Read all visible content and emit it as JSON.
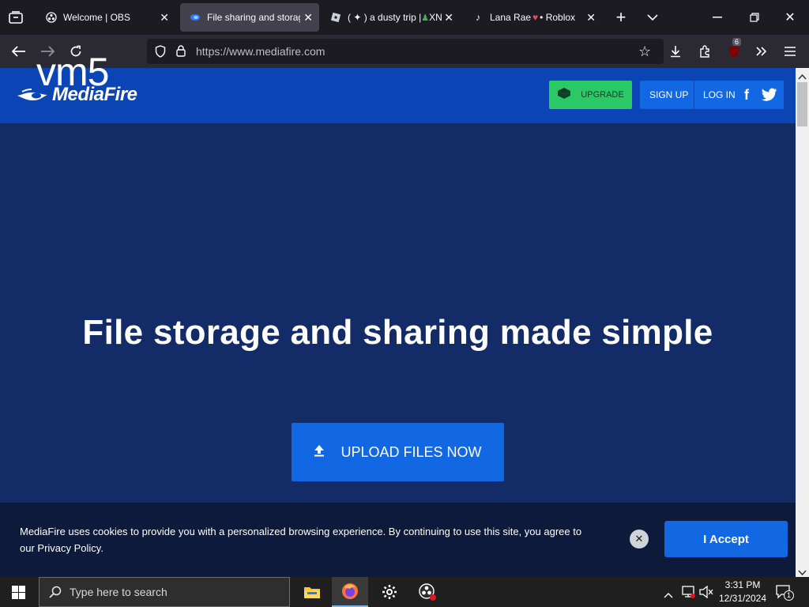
{
  "overlay_label": "vm5",
  "browser": {
    "tabs": [
      {
        "title": "Welcome | OBS",
        "icon": "obs-icon",
        "active": false
      },
      {
        "title": "File sharing and storag",
        "icon": "mediafire-icon",
        "active": true
      },
      {
        "title": "( ✦ ) a dusty trip | ",
        "suffix": "XN",
        "icon": "roblox-icon",
        "active": false
      },
      {
        "title": "Lana Rae ",
        "suffix": " • Roblox",
        "icon": "tiktok-icon",
        "active": false
      }
    ],
    "url": "https://www.mediafire.com",
    "extension_badge": "6"
  },
  "site": {
    "logo_text": "MediaFire",
    "upgrade_label": "UPGRADE",
    "signup_label": "SIGN UP",
    "login_label": "LOG IN",
    "hero_title": "File storage and sharing made simple",
    "upload_label": "UPLOAD FILES NOW"
  },
  "cookie_banner": {
    "text": "MediaFire uses cookies to provide you with a personalized browsing experience. By continuing to use this site, you agree to our Privacy Policy.",
    "close_symbol": "✕",
    "accept_label": "I Accept"
  },
  "taskbar": {
    "search_placeholder": "Type here to search",
    "time": "3:31 PM",
    "date": "12/31/2024",
    "notification_count": "1"
  },
  "colors": {
    "header_blue": "#0b45b5",
    "hero_bg": "#132b66",
    "button_blue": "#1268e3",
    "upgrade_green": "#2bc866"
  }
}
